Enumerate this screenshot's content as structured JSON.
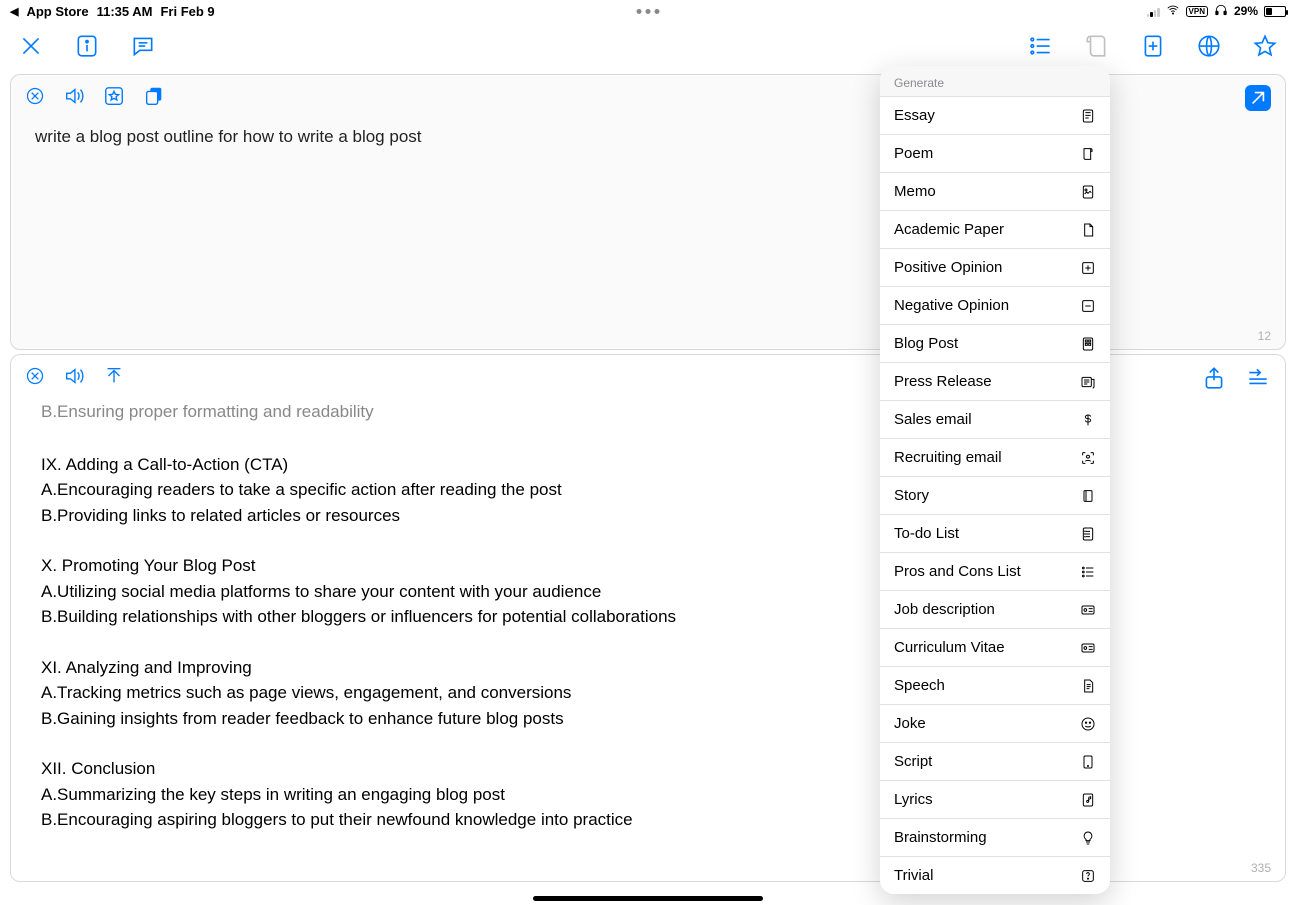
{
  "status": {
    "back_app": "App Store",
    "time": "11:35 AM",
    "date": "Fri Feb 9",
    "vpn": "VPN",
    "battery_pct": "29%"
  },
  "card1": {
    "prompt": "write a blog post outline for how to write a blog post",
    "count": "12"
  },
  "card2": {
    "count": "335",
    "lines": [
      "B.Ensuring proper formatting and readability",
      "",
      "IX. Adding a Call-to-Action (CTA)",
      "A.Encouraging readers to take a specific action after reading the post",
      "B.Providing links to related articles or resources",
      "",
      "X. Promoting Your Blog Post",
      "A.Utilizing social media platforms to share your content with your audience",
      "B.Building relationships with other bloggers or influencers for potential collaborations",
      "",
      "XI. Analyzing and Improving",
      "A.Tracking metrics such as page views, engagement, and conversions",
      "B.Gaining insights from reader feedback to enhance future blog posts",
      "",
      "XII. Conclusion",
      "A.Summarizing the key steps in writing an engaging blog post",
      "B.Encouraging aspiring bloggers to put their newfound knowledge into practice"
    ]
  },
  "menu": {
    "header": "Generate",
    "items": [
      {
        "label": "Essay",
        "icon": "doc"
      },
      {
        "label": "Poem",
        "icon": "scroll"
      },
      {
        "label": "Memo",
        "icon": "note"
      },
      {
        "label": "Academic Paper",
        "icon": "page"
      },
      {
        "label": "Positive Opinion",
        "icon": "plus-sq"
      },
      {
        "label": "Negative Opinion",
        "icon": "minus-sq"
      },
      {
        "label": "Blog Post",
        "icon": "grid"
      },
      {
        "label": "Press Release",
        "icon": "news"
      },
      {
        "label": "Sales email",
        "icon": "dollar"
      },
      {
        "label": "Recruiting email",
        "icon": "person-scan"
      },
      {
        "label": "Story",
        "icon": "book"
      },
      {
        "label": "To-do List",
        "icon": "list-doc"
      },
      {
        "label": "Pros and Cons List",
        "icon": "bullets"
      },
      {
        "label": "Job description",
        "icon": "id"
      },
      {
        "label": "Curriculum Vitae",
        "icon": "id"
      },
      {
        "label": "Speech",
        "icon": "page-lines"
      },
      {
        "label": "Joke",
        "icon": "smile"
      },
      {
        "label": "Script",
        "icon": "tablet"
      },
      {
        "label": "Lyrics",
        "icon": "music-doc"
      },
      {
        "label": "Brainstorming",
        "icon": "bulb"
      },
      {
        "label": "Trivial",
        "icon": "question"
      }
    ]
  }
}
